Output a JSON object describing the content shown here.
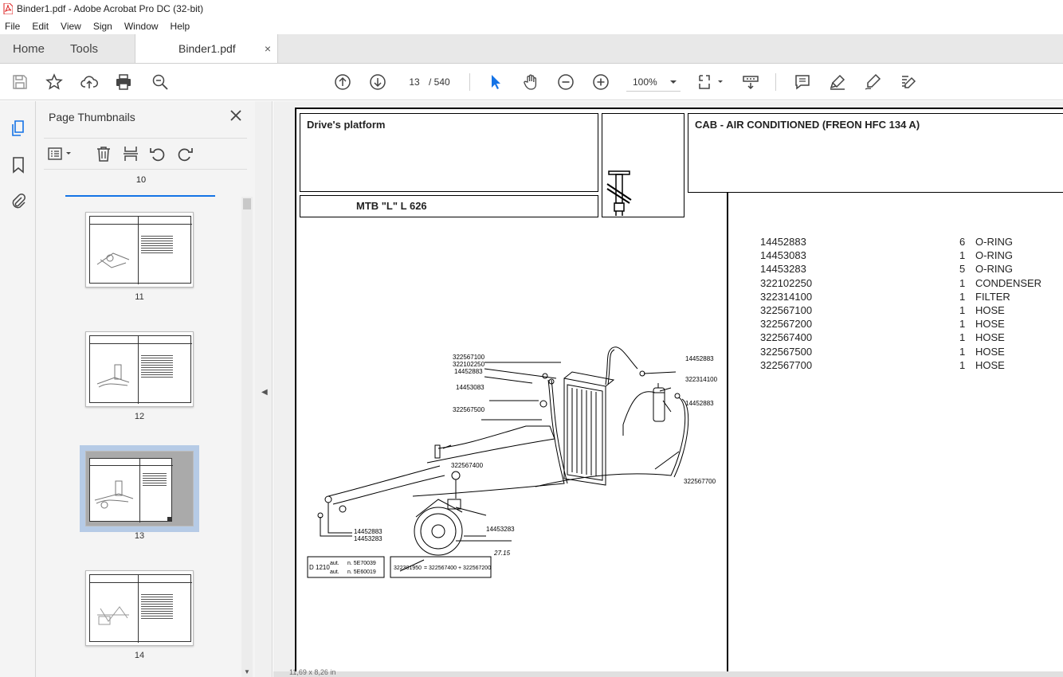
{
  "window": {
    "title": "Binder1.pdf - Adobe Acrobat Pro DC (32-bit)"
  },
  "menu": [
    "File",
    "Edit",
    "View",
    "Sign",
    "Window",
    "Help"
  ],
  "tabs": {
    "home": "Home",
    "tools": "Tools",
    "document": "Binder1.pdf",
    "close": "×"
  },
  "toolbar": {
    "current_page": "13",
    "page_total": "/ 540",
    "zoom": "100%"
  },
  "thumbnails_panel": {
    "title": "Page Thumbnails",
    "items": [
      {
        "label": "10"
      },
      {
        "label": "11"
      },
      {
        "label": "12"
      },
      {
        "label": "13",
        "selected": true
      },
      {
        "label": "14"
      }
    ]
  },
  "document": {
    "section": "Drive's platform",
    "model": "MTB \"L\" L 626",
    "group_title": "CAB - AIR CONDITIONED (FREON  HFC 134 A)",
    "parts": [
      {
        "number": "14452883",
        "qty": "6",
        "desc": "O-RING"
      },
      {
        "number": "14453083",
        "qty": "1",
        "desc": "O-RING"
      },
      {
        "number": "14453283",
        "qty": "5",
        "desc": "O-RING"
      },
      {
        "number": "322102250",
        "qty": "1",
        "desc": "CONDENSER"
      },
      {
        "number": "322314100",
        "qty": "1",
        "desc": "FILTER"
      },
      {
        "number": "322567100",
        "qty": "1",
        "desc": "HOSE"
      },
      {
        "number": "322567200",
        "qty": "1",
        "desc": "HOSE"
      },
      {
        "number": "322567400",
        "qty": "1",
        "desc": "HOSE"
      },
      {
        "number": "322567500",
        "qty": "1",
        "desc": "HOSE"
      },
      {
        "number": "322567700",
        "qty": "1",
        "desc": "HOSE"
      }
    ],
    "diagram_labels": {
      "l1": "322567100",
      "l2": "322102250",
      "l3": "14452883",
      "l4": "14453083",
      "l5": "322567500",
      "l6": "14452883",
      "l7": "322314100",
      "l8": "14452883",
      "l9": "322567400",
      "l10": "322567700",
      "l11": "14452883",
      "l12": "14453283",
      "l13": "14453283",
      "l14": "27.15"
    },
    "footnote_left": {
      "code": "D 1210",
      "aut1": "aut.",
      "aut2": "aut.",
      "n1": "n. 5E70039",
      "n2": "n. 5E60019"
    },
    "footnote_right": {
      "old": "322301950",
      "new": "= 322567400 + 322567200"
    }
  },
  "status": {
    "size": "11,69 x 8,26 in"
  }
}
